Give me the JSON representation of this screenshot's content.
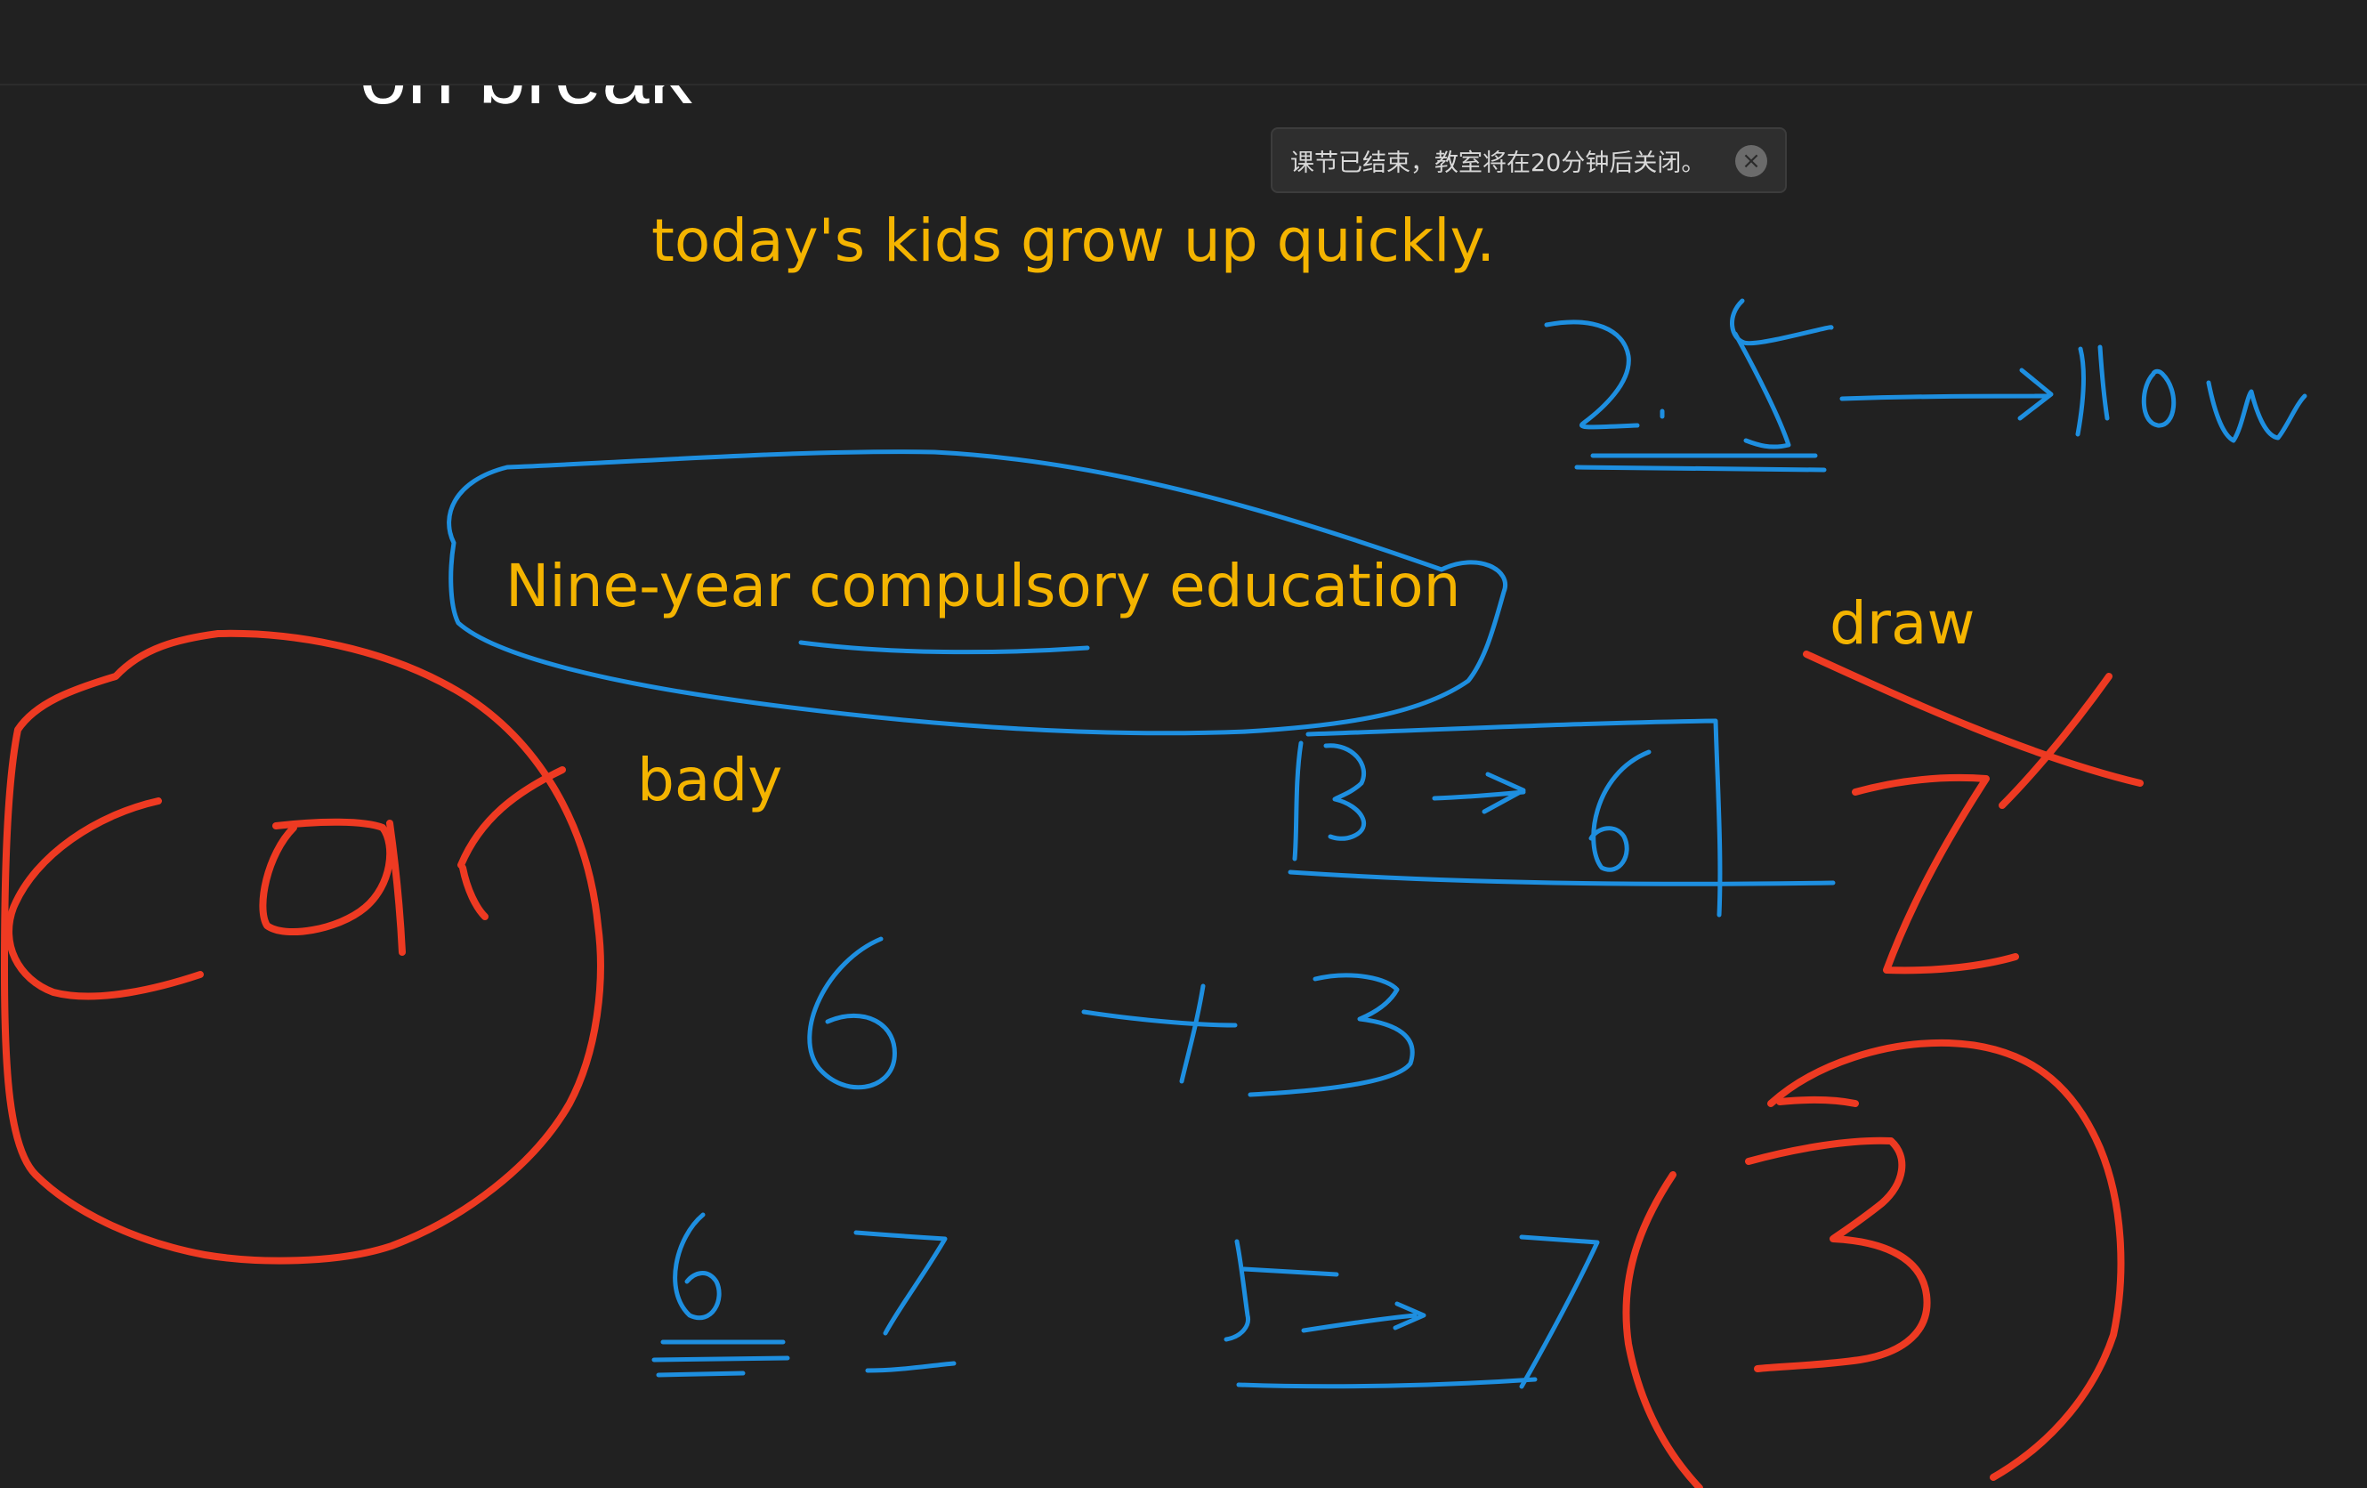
{
  "slide": {
    "partial_title": "on break",
    "lines": {
      "kids": "today's kids grow up quickly.",
      "education": "Nine-year compulsory education",
      "bady": "bady",
      "draw": "draw"
    }
  },
  "notification": {
    "message": "课节已结束，教室将在20分钟后关闭。",
    "close_glyph": "×"
  },
  "colors": {
    "background": "#212121",
    "slide_text": "#f4b400",
    "title_text": "#ffffff",
    "blue_ink": "#1e8fe0",
    "red_ink": "#ee3a22"
  }
}
